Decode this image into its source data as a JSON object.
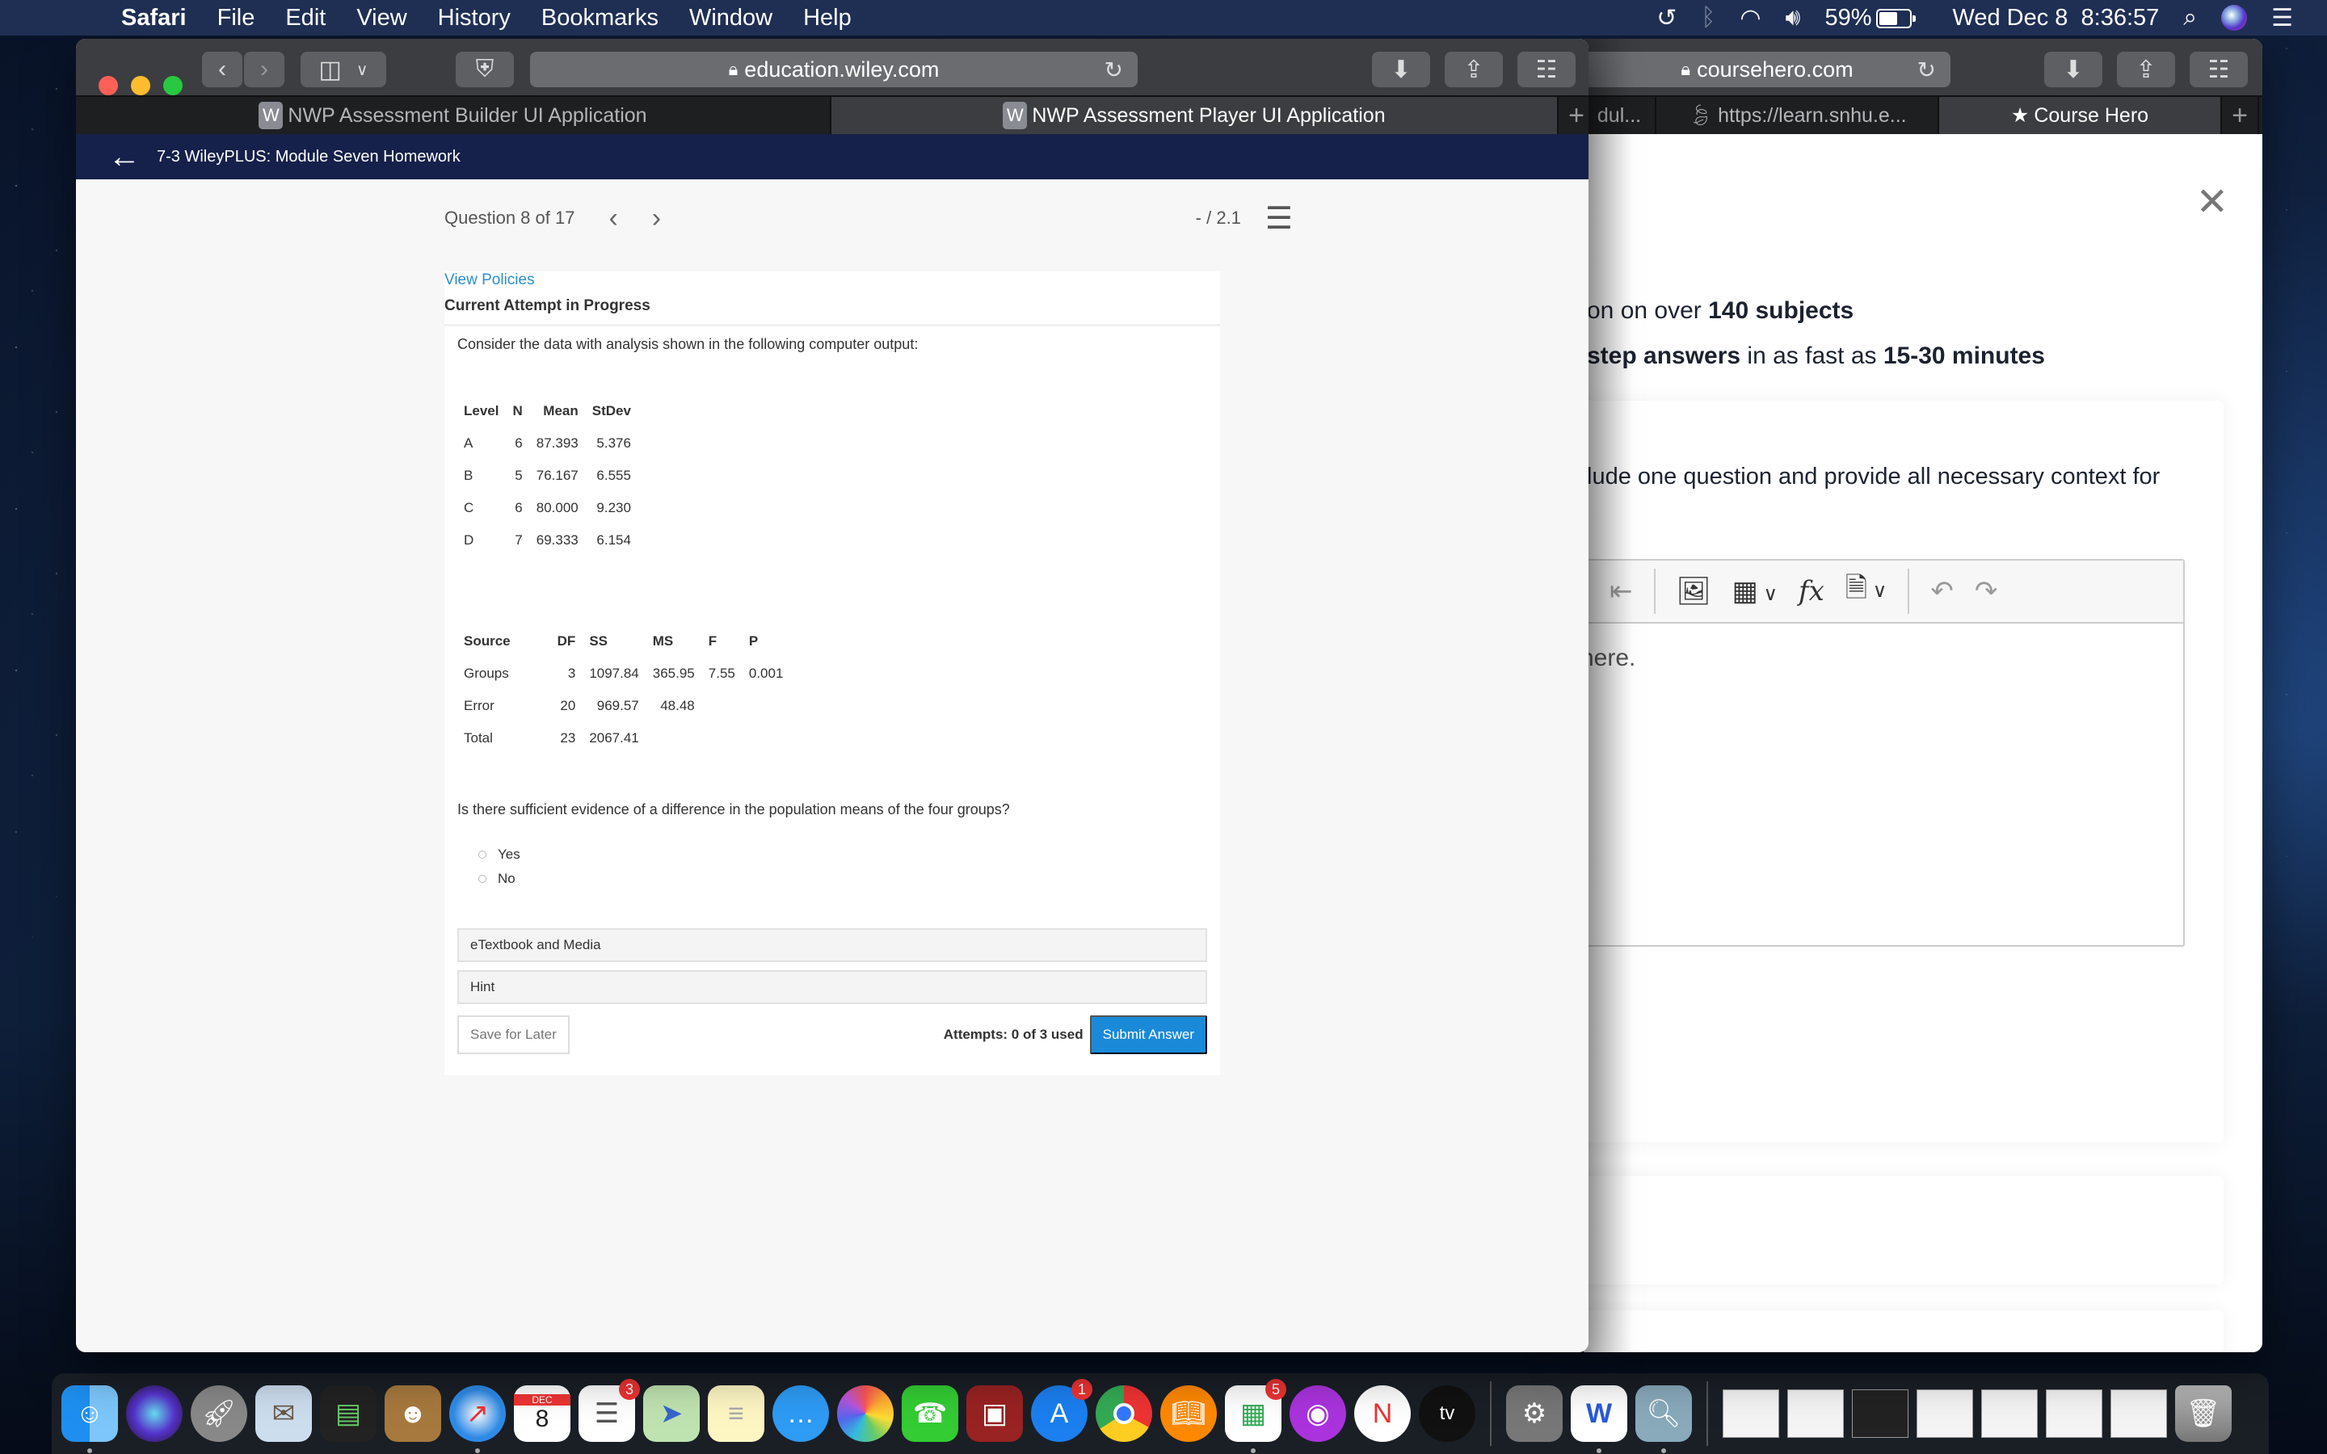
{
  "menubar": {
    "app_name": "Safari",
    "menus": [
      "File",
      "Edit",
      "View",
      "History",
      "Bookmarks",
      "Window",
      "Help"
    ],
    "battery_percent": "59%",
    "datetime": "Wed Dec 8  8:36:57",
    "icons": [
      "apple-icon",
      "time-machine-icon",
      "bluetooth-icon",
      "wifi-icon",
      "volume-icon",
      "battery-icon",
      "spotlight-search-icon",
      "siri-icon",
      "notification-center-icon"
    ]
  },
  "left_window": {
    "url": "education.wiley.com",
    "tabs": [
      {
        "label": "NWP Assessment Builder UI Application",
        "favicon": "W",
        "active": false
      },
      {
        "label": "NWP Assessment Player UI Application",
        "favicon": "W",
        "active": true
      }
    ],
    "header_title": "7-3 WileyPLUS: Module Seven Homework",
    "question_counter": "Question 8 of 17",
    "score": "- / 2.1",
    "view_policies": "View Policies",
    "attempt_status": "Current Attempt in Progress",
    "prompt": "Consider the data with analysis shown in the following computer output:",
    "descriptive_table": {
      "headers": [
        "Level",
        "N",
        "Mean",
        "StDev"
      ],
      "rows": [
        [
          "A",
          "6",
          "87.393",
          "5.376"
        ],
        [
          "B",
          "5",
          "76.167",
          "6.555"
        ],
        [
          "C",
          "6",
          "80.000",
          "9.230"
        ],
        [
          "D",
          "7",
          "69.333",
          "6.154"
        ]
      ]
    },
    "anova_table": {
      "headers": [
        "Source",
        "DF",
        "SS",
        "MS",
        "F",
        "P"
      ],
      "rows": [
        [
          "Groups",
          "3",
          "1097.84",
          "365.95",
          "7.55",
          "0.001"
        ],
        [
          "Error",
          "20",
          "969.57",
          "48.48",
          "",
          ""
        ],
        [
          "Total",
          "23",
          "2067.41",
          "",
          "",
          ""
        ]
      ]
    },
    "question": "Is there sufficient evidence of a difference in the population means of the four groups?",
    "choices": [
      "Yes",
      "No"
    ],
    "etextbook_label": "eTextbook and Media",
    "hint_label": "Hint",
    "save_label": "Save for Later",
    "attempts_label": "Attempts: 0 of 3 used",
    "submit_label": "Submit Answer"
  },
  "right_window": {
    "url": "coursehero.com",
    "tabs": [
      {
        "label": "dul...",
        "active": false
      },
      {
        "label": "https://learn.snhu.e...",
        "active": false
      },
      {
        "label": "Course Hero",
        "active": true
      }
    ],
    "line1_prefix": "on on over ",
    "line1_bold": "140 subjects",
    "line2_bold1": "step answers",
    "line2_mid": " in as fast as ",
    "line2_bold2": "15-30 minutes",
    "instruction": "lude one question and provide all necessary context for",
    "editor_placeholder": "here."
  },
  "dock": {
    "apps": [
      {
        "name": "Finder",
        "running": true
      },
      {
        "name": "Siri"
      },
      {
        "name": "Launchpad"
      },
      {
        "name": "Mail"
      },
      {
        "name": "Mission Control"
      },
      {
        "name": "Contacts"
      },
      {
        "name": "Safari",
        "running": true
      },
      {
        "name": "Calendar",
        "label": "8",
        "month": "DEC"
      },
      {
        "name": "Reminders",
        "badge": "3"
      },
      {
        "name": "Maps"
      },
      {
        "name": "Notes"
      },
      {
        "name": "Messages"
      },
      {
        "name": "Photos"
      },
      {
        "name": "FaceTime"
      },
      {
        "name": "Photo Booth"
      },
      {
        "name": "App Store",
        "badge": "1"
      },
      {
        "name": "Chrome"
      },
      {
        "name": "Books"
      },
      {
        "name": "Microsoft Store",
        "badge": "5",
        "running": true
      },
      {
        "name": "Podcasts"
      },
      {
        "name": "News"
      },
      {
        "name": "TV",
        "label": "tv"
      },
      {
        "name": "System Preferences"
      },
      {
        "name": "Word",
        "running": true
      },
      {
        "name": "Preview",
        "running": true
      }
    ]
  }
}
